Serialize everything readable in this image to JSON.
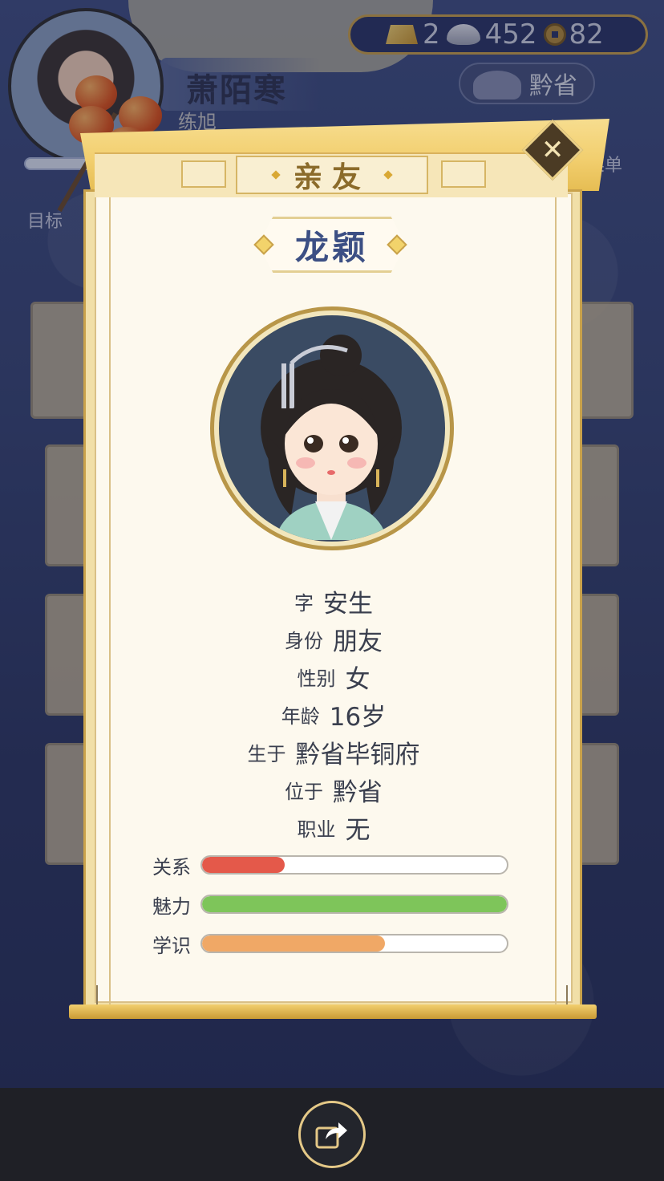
{
  "hud": {
    "player_name": "萧陌寒",
    "player_subtitle": "练旭",
    "currency": {
      "gold": "2",
      "silver": "452",
      "copper": "82"
    },
    "location_button": "黔省",
    "goal_label": "目标",
    "menu_label": "菜单"
  },
  "dialog": {
    "title": "亲友",
    "character_name": "龙颖",
    "info": [
      {
        "key": "字",
        "value": "安生"
      },
      {
        "key": "身份",
        "value": "朋友"
      },
      {
        "key": "性别",
        "value": "女"
      },
      {
        "key": "年龄",
        "value": "16岁"
      },
      {
        "key": "生于",
        "value": "黔省毕铜府"
      },
      {
        "key": "位于",
        "value": "黔省"
      },
      {
        "key": "职业",
        "value": "无"
      }
    ],
    "stats": [
      {
        "label": "关系",
        "fraction": 0.27,
        "color": "#e4594a"
      },
      {
        "label": "魅力",
        "fraction": 1.0,
        "color": "#7ec55a"
      },
      {
        "label": "学识",
        "fraction": 0.6,
        "color": "#f0a866"
      }
    ]
  },
  "colors": {
    "accent_gold": "#c9a24b",
    "name_blue": "#3c4f84",
    "paper": "#fdf9ee"
  },
  "icons": [
    "close-icon",
    "share-icon",
    "gold-ingot-icon",
    "silver-ingot-icon",
    "copper-coin-icon",
    "location-icon"
  ]
}
